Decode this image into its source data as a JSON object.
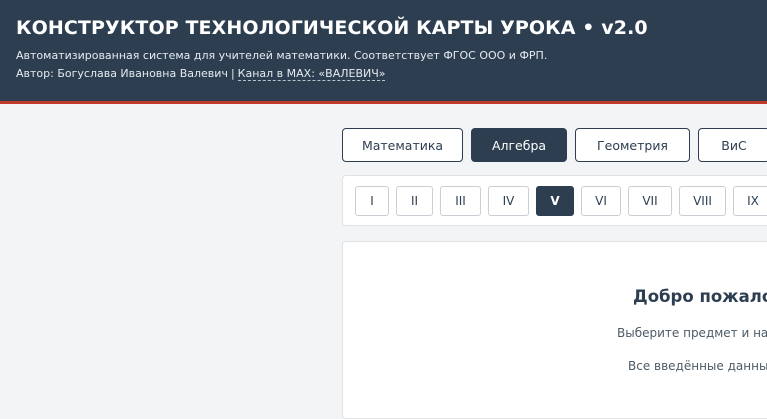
{
  "header": {
    "title": "КОНСТРУКТОР ТЕХНОЛОГИЧЕСКОЙ КАРТЫ УРОКА • v2.0",
    "description": "Автоматизированная система для учителей математики. Соответствует ФГОС ООО и ФРП.",
    "author": "Автор: Богуслава Ивановна Валевич",
    "separator": "|",
    "channel_link": "Канал в MAX: «ВАЛЕВИЧ»"
  },
  "subjects": [
    {
      "label": "Математика",
      "active": false
    },
    {
      "label": "Алгебра",
      "active": true
    },
    {
      "label": "Геометрия",
      "active": false
    },
    {
      "label": "ВиС",
      "active": false
    }
  ],
  "grades": [
    {
      "label": "I",
      "active": false
    },
    {
      "label": "II",
      "active": false
    },
    {
      "label": "III",
      "active": false
    },
    {
      "label": "IV",
      "active": false
    },
    {
      "label": "V",
      "active": true
    },
    {
      "label": "VI",
      "active": false
    },
    {
      "label": "VII",
      "active": false
    },
    {
      "label": "VIII",
      "active": false
    },
    {
      "label": "IX",
      "active": false
    }
  ],
  "welcome": {
    "title": "Добро пожалов",
    "line1": "Выберите предмет и наж",
    "line2": "Все введённые данные"
  },
  "colors": {
    "header_bg": "#2c3e50",
    "accent_line": "#c0392b",
    "page_bg": "#f3f4f5"
  }
}
